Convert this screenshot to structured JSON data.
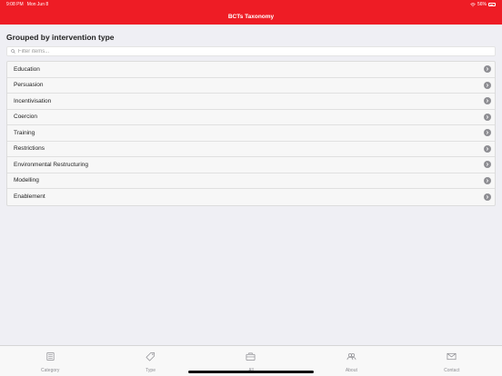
{
  "status_bar": {
    "time": "9:08 PM",
    "date": "Mon Jun 8",
    "battery": "56%",
    "battery_level": 0.56
  },
  "navbar": {
    "title": "BCTs Taxonomy",
    "background": "#ee1c25"
  },
  "section": {
    "title": "Grouped by intervention type"
  },
  "search": {
    "placeholder": "Filter items...",
    "value": ""
  },
  "list": {
    "items": [
      {
        "label": "Education"
      },
      {
        "label": "Persuasion"
      },
      {
        "label": "Incentivisation"
      },
      {
        "label": "Coercion"
      },
      {
        "label": "Training"
      },
      {
        "label": "Restrictions"
      },
      {
        "label": "Environmental Restructuring"
      },
      {
        "label": "Modelling"
      },
      {
        "label": "Enablement"
      }
    ]
  },
  "tabbar": {
    "tabs": [
      {
        "label": "Category",
        "icon": "category-icon"
      },
      {
        "label": "Type",
        "icon": "tag-icon"
      },
      {
        "label": "All",
        "icon": "briefcase-icon"
      },
      {
        "label": "About",
        "icon": "people-icon"
      },
      {
        "label": "Contact",
        "icon": "mail-icon"
      }
    ]
  }
}
